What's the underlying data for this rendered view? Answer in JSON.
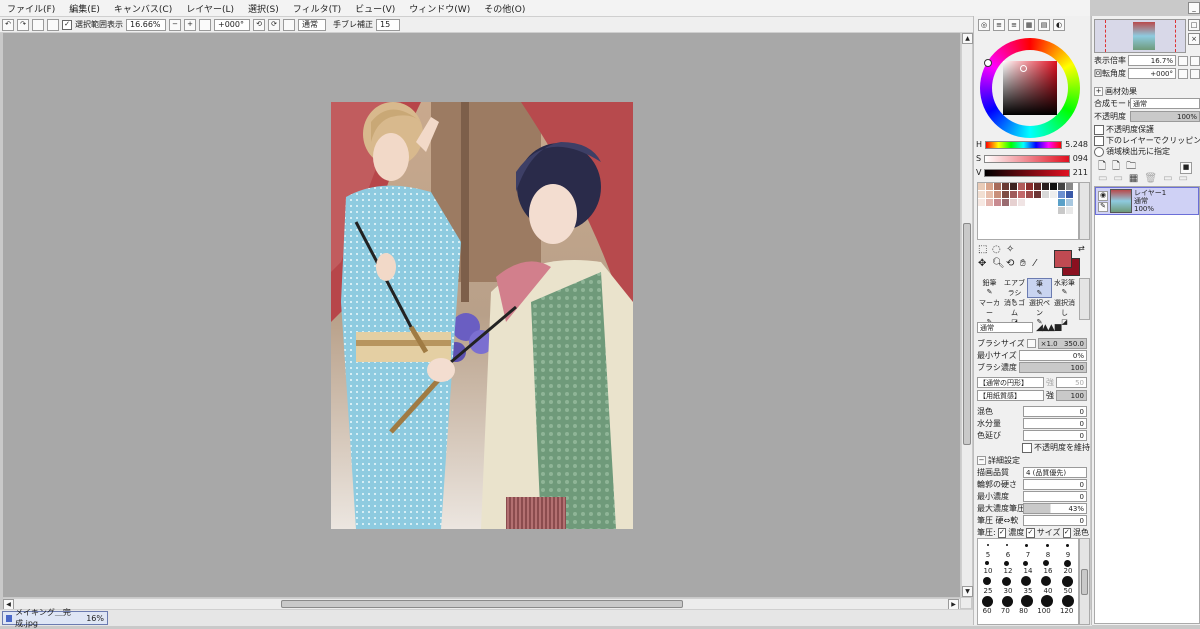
{
  "menu": [
    "ファイル(F)",
    "編集(E)",
    "キャンバス(C)",
    "レイヤー(L)",
    "選択(S)",
    "フィルタ(T)",
    "ビュー(V)",
    "ウィンドウ(W)",
    "その他(O)"
  ],
  "toolbar": {
    "selection_label": "選択範囲表示",
    "zoom": "16.66%",
    "rotation": "+000°",
    "blend": "通常",
    "stabilizer_label": "手ブレ補正",
    "stabilizer_value": "15"
  },
  "taskbar": {
    "doc_name": "メイキング＿完成.jpg",
    "zoom": "16%"
  },
  "hsv": {
    "h_label": "H",
    "h_value": "5.248",
    "s_label": "S",
    "s_value": "094",
    "v_label": "V",
    "v_value": "211"
  },
  "colors": {
    "main": "#8a1020",
    "sub": "#c04a52",
    "accent": "#4a56c8"
  },
  "brushes": {
    "row1": [
      "鉛筆",
      "エアブラシ",
      "筆",
      "水彩筆"
    ],
    "row2": [
      "マーカー",
      "消しゴム",
      "選択ペン",
      "選択消し"
    ]
  },
  "brush_props": {
    "blend_mode": "通常",
    "size_label": "ブラシサイズ",
    "size_mult": "×1.0",
    "size_value": "350.0",
    "min_size_label": "最小サイズ",
    "min_size_value": "0%",
    "density_label": "ブラシ濃度",
    "density_value": "100",
    "shape1": "【通常の円形】",
    "shape1_value": "50",
    "shape2": "【用紙質感】",
    "shape2_value": "100",
    "strength_label": "強",
    "mix_label": "混色",
    "mix_value": "0",
    "water_label": "水分量",
    "water_value": "0",
    "stretch_label": "色延び",
    "stretch_value": "0",
    "keep_opacity_label": "不透明度を維持",
    "advanced_label": "詳細設定",
    "quality_label": "描画品質",
    "quality_value": "4 (品質優先)",
    "edge_label": "輪郭の硬さ",
    "edge_value": "0",
    "min_density_label": "最小濃度",
    "min_density_value": "0",
    "max_pressure_label": "最大濃度筆圧",
    "max_pressure_value": "43%",
    "pressure_hard_label": "筆圧 硬⇔軟",
    "pressure_hard_value": "0",
    "pressure_label": "筆圧:",
    "pressure_density": "濃度",
    "pressure_size": "サイズ",
    "pressure_mix": "混色"
  },
  "brush_sizes": {
    "row_a": [
      "5",
      "6",
      "7",
      "8",
      "9"
    ],
    "row_b": [
      "10",
      "12",
      "14",
      "16",
      "20"
    ],
    "row_c": [
      "25",
      "30",
      "35",
      "40",
      "50"
    ],
    "row_d": [
      "60",
      "70",
      "80",
      "100",
      "120"
    ]
  },
  "layer_panel": {
    "display_label": "表示倍率",
    "display_value": "16.7%",
    "rotation_label": "回転角度",
    "rotation_value": "+000°",
    "effect_label": "画材効果",
    "mode_label": "合成モード",
    "mode_value": "通常",
    "opacity_label": "不透明度",
    "opacity_value": "100%",
    "protect_label": "不透明度保護",
    "clip_label": "下のレイヤーでクリッピング",
    "source_label": "領域検出元に指定",
    "layer_name": "レイヤー1",
    "layer_mode": "通常",
    "layer_opacity": "100%"
  }
}
